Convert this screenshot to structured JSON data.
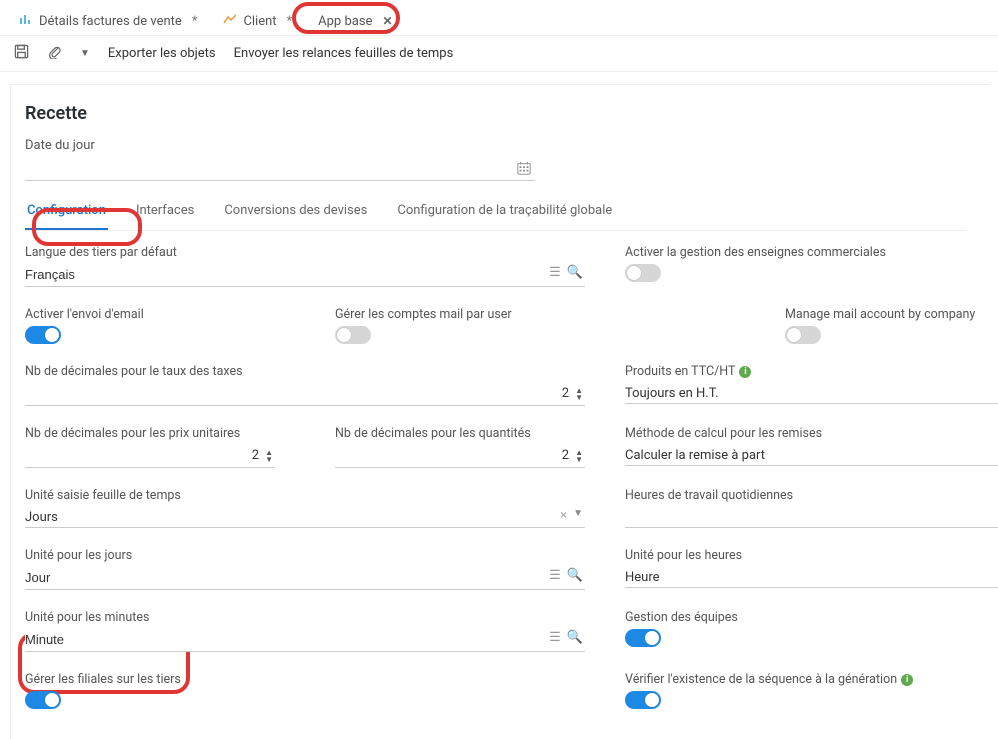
{
  "tabs": [
    {
      "label": "Détails factures de vente",
      "dirty": "*"
    },
    {
      "label": "Client",
      "dirty": "*"
    },
    {
      "label": "App base",
      "dirty": ""
    }
  ],
  "toolbar": {
    "export": "Exporter les objets",
    "send": "Envoyer les relances feuilles de temps"
  },
  "page_title": "Recette",
  "date_label": "Date du jour",
  "inner_tabs": {
    "config": "Configuration",
    "interfaces": "Interfaces",
    "currencies": "Conversions des devises",
    "traceability": "Configuration de la traçabilité globale"
  },
  "fields": {
    "default_lang_label": "Langue des tiers par défaut",
    "default_lang_value": "Français",
    "brand_mgmt_label": "Activer la gestion des enseignes commerciales",
    "enable_email_label": "Activer l'envoi d'email",
    "mail_per_user_label": "Gérer les comptes mail par user",
    "mail_per_company_label": "Manage mail account by company",
    "tax_decimals_label": "Nb de décimales pour le taux des taxes",
    "tax_decimals_value": "2",
    "products_ttcxht_label": "Produits en TTC/HT",
    "products_ttcxht_value": "Toujours en H.T.",
    "unit_price_decimals_label": "Nb de décimales pour les prix unitaires",
    "unit_price_decimals_value": "2",
    "qty_decimals_label": "Nb de décimales pour les quantités",
    "qty_decimals_value": "2",
    "discount_method_label": "Méthode de calcul pour les remises",
    "discount_method_value": "Calculer la remise à part",
    "timesheet_unit_label": "Unité saisie feuille de temps",
    "timesheet_unit_value": "Jours",
    "daily_hours_label": "Heures de travail quotidiennes",
    "unit_days_label": "Unité pour les jours",
    "unit_days_value": "Jour",
    "unit_hours_label": "Unité pour les heures",
    "unit_hours_value": "Heure",
    "unit_minutes_label": "Unité pour les minutes",
    "unit_minutes_value": "Minute",
    "team_mgmt_label": "Gestion des équipes",
    "subsidiaries_label": "Gérer les filiales sur les tiers",
    "seq_check_label": "Vérifier l'existence de la séquence à la génération"
  }
}
